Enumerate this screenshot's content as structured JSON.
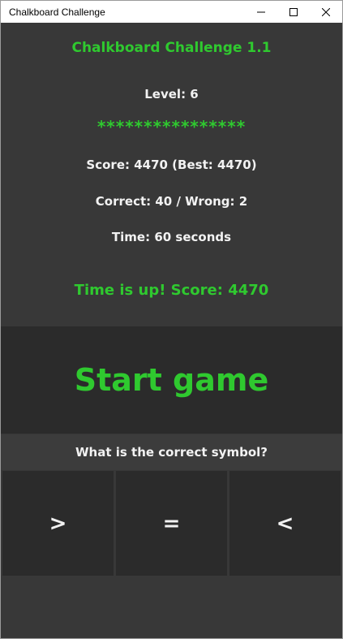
{
  "window": {
    "title": "Chalkboard Challenge",
    "controls": [
      "minimize-icon",
      "maximize-icon",
      "close-icon"
    ]
  },
  "game": {
    "app_title": "Chalkboard Challenge 1.1",
    "level": "Level: 6",
    "stars": "****************",
    "score": "Score: 4470 (Best: 4470)",
    "correct_wrong": "Correct: 40 / Wrong: 2",
    "time": "Time: 60 seconds",
    "status": "Time is up! Score: 4470",
    "start_label": "Start game",
    "question": "What is the correct symbol?",
    "answers": [
      ">",
      "=",
      "<"
    ]
  },
  "colors": {
    "accent": "#2fc92f",
    "background": "#383838",
    "button": "#2b2b2b",
    "text": "#f2f2f2"
  }
}
